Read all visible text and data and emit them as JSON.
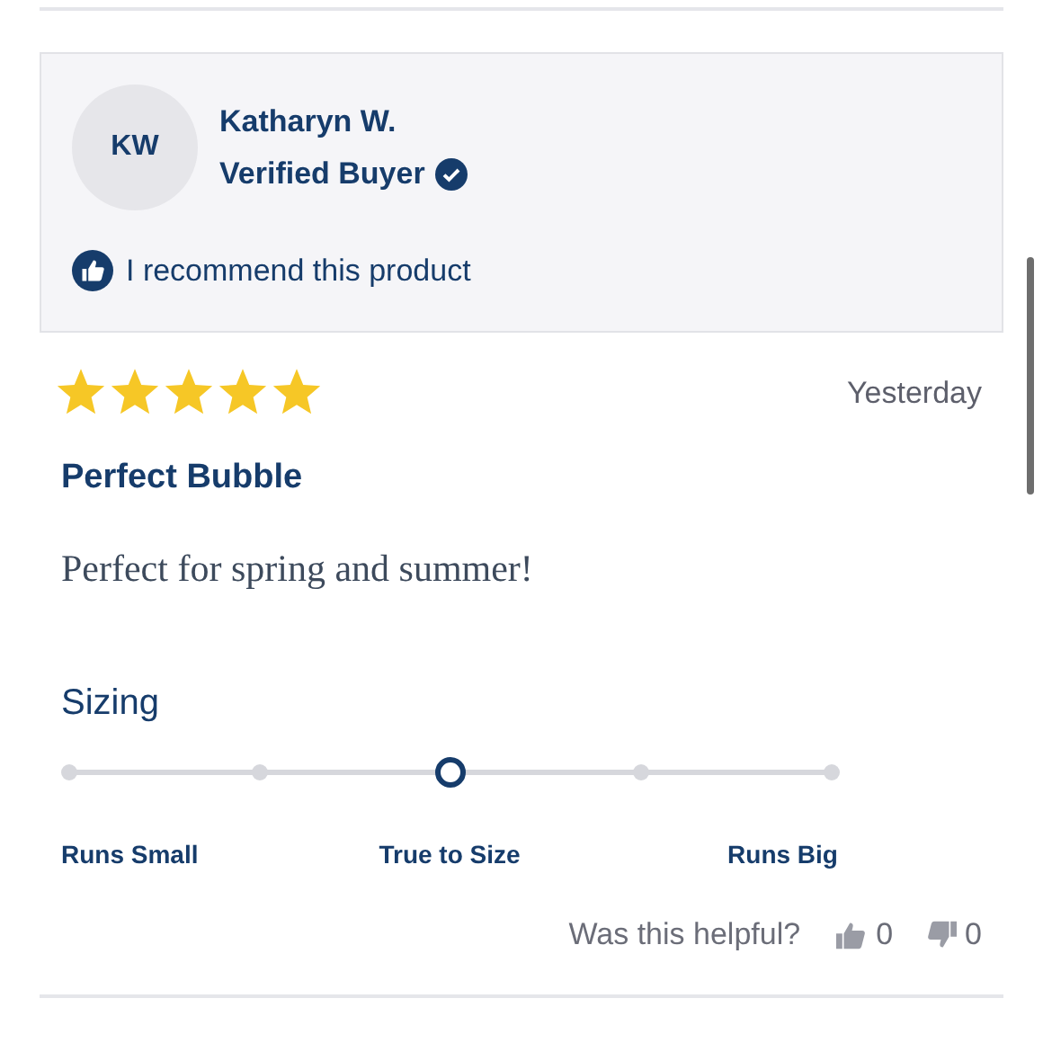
{
  "reviewer": {
    "initials": "KW",
    "name": "Katharyn W.",
    "badge": "Verified Buyer",
    "verified": true,
    "recommendation": "I recommend this product"
  },
  "review": {
    "stars": 5,
    "date": "Yesterday",
    "title": "Perfect Bubble",
    "body": "Perfect for spring and summer!"
  },
  "sizing": {
    "title": "Sizing",
    "level": 0.5,
    "labels": [
      "Runs Small",
      "True to Size",
      "Runs Big"
    ]
  },
  "helpful": {
    "question": "Was this helpful?",
    "up_count": "0",
    "down_count": "0"
  }
}
